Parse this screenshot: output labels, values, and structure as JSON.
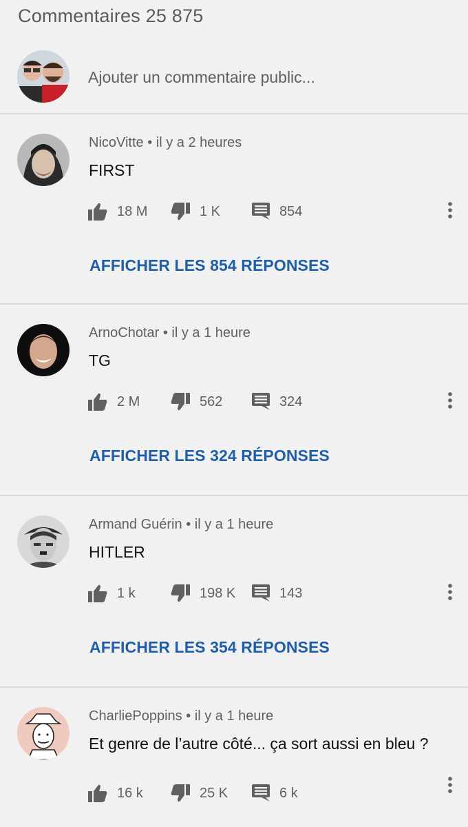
{
  "header": {
    "title": "Commentaires 25 875",
    "add_comment_placeholder": "Ajouter un commentaire public..."
  },
  "comments": [
    {
      "author": "NicoVitte",
      "time": "il y a 2 heures",
      "text": "FIRST",
      "likes": "18 M",
      "dislikes": "1 K",
      "replies_count": "854",
      "show_replies_label": "AFFICHER LES 854 RÉPONSES"
    },
    {
      "author": "ArnoChotar",
      "time": "il y a 1 heure",
      "text": "TG",
      "likes": "2 M",
      "dislikes": "562",
      "replies_count": "324",
      "show_replies_label": "AFFICHER LES 324 RÉPONSES"
    },
    {
      "author": "Armand Guérin",
      "time": "il y a 1 heure",
      "text": "HITLER",
      "likes": "1 k",
      "dislikes": "198 K",
      "replies_count": "143",
      "show_replies_label": "AFFICHER LES 354 RÉPONSES"
    },
    {
      "author": "CharliePoppins",
      "time": "il y a 1 heure",
      "text": "Et genre de l’autre côté... ça sort aussi en bleu ?",
      "likes": "16 k",
      "dislikes": "25 K",
      "replies_count": "6 k",
      "show_replies_label": ""
    }
  ],
  "icons": {
    "like": "thumbs-up-icon",
    "dislike": "thumbs-down-icon",
    "reply": "comment-icon",
    "more": "more-vertical-icon"
  },
  "colors": {
    "background": "#f1f1f1",
    "link_blue": "#1f5ea8",
    "secondary_text": "#606060"
  }
}
